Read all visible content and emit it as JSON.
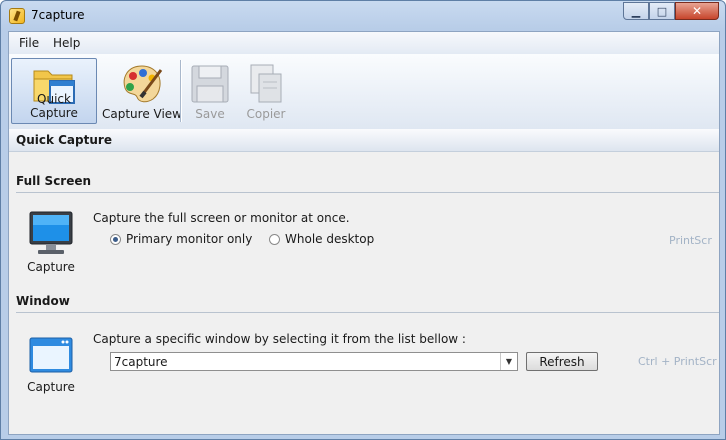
{
  "window": {
    "title": "7capture",
    "minimize": "▁",
    "maximize": "□",
    "close": "✕"
  },
  "menu": [
    "File",
    "Help"
  ],
  "toolbar": {
    "quick_capture": "Quick Capture",
    "capture_view": "Capture View",
    "save": "Save",
    "copier": "Copier"
  },
  "section_title": "Quick Capture",
  "full_screen": {
    "title": "Full Screen",
    "capture_label": "Capture",
    "description": "Capture the full screen or monitor at once.",
    "options": [
      "Primary monitor only",
      "Whole desktop"
    ],
    "selected": "Primary monitor only",
    "shortcut": "PrintScr"
  },
  "window_capture": {
    "title": "Window",
    "capture_label": "Capture",
    "description": "Capture a specific window by selecting it from the list bellow :",
    "selected_window": "7capture",
    "refresh_label": "Refresh",
    "shortcut": "Ctrl + PrintScr"
  },
  "icons": {
    "app": "app-icon",
    "quick_capture": "folder-window-icon",
    "capture_view": "palette-icon",
    "save": "floppy-disk-icon",
    "copier": "copy-document-icon",
    "monitor": "monitor-icon",
    "window": "window-icon"
  },
  "colors": {
    "accent": "#3c5d8a",
    "shortcut": "#a3b3c6"
  }
}
